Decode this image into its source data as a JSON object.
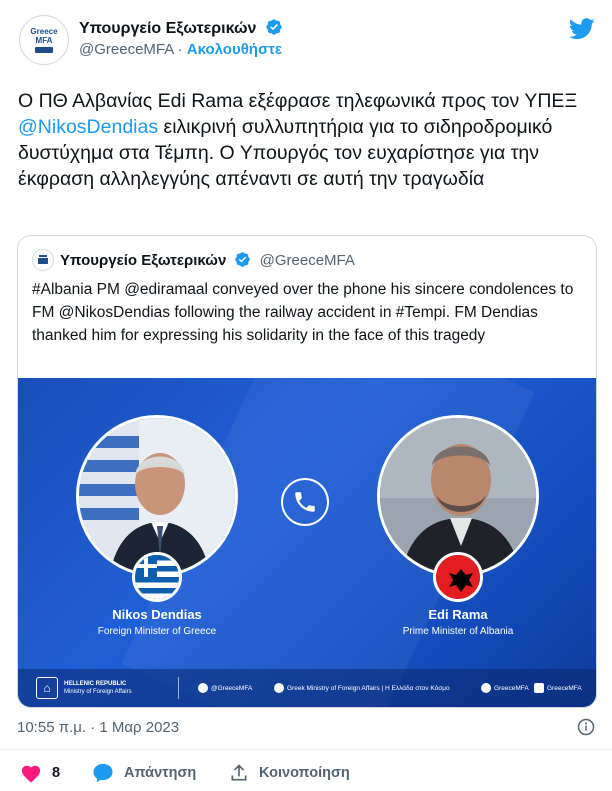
{
  "header": {
    "avatar_line1": "Greece",
    "avatar_line2": "MFA",
    "name": "Υπουργείο Εξωτερικών",
    "handle": "@GreeceMFA",
    "separator": "·",
    "follow": "Ακολουθήστε"
  },
  "tweet": {
    "text_before": "Ο ΠΘ Αλβανίας Edi Rama εξέφρασε τηλεφωνικά προς τον ΥΠΕΞ ",
    "mention": "@NikosDendias",
    "text_after": " ειλικρινή συλλυπητήρια για το σιδηροδρομικό δυστύχημα στα Τέμπη. Ο Υπουργός τον ευχαρίστησε για την έκφραση αλληλεγγύης απέναντι σε αυτή την τραγωδία"
  },
  "quote": {
    "name": "Υπουργείο Εξωτερικών",
    "handle": "@GreeceMFA",
    "text": "#Albania PM @ediramaal conveyed over the phone his sincere condolences to FM @NikosDendias following the railway accident in #Tempi. FM Dendias thanked him for expressing his solidarity in the face of this tragedy",
    "image": {
      "left_name": "Nikos Dendias",
      "left_title": "Foreign Minister of Greece",
      "right_name": "Edi Rama",
      "right_title": "Prime Minister of Albania",
      "org_line1": "HELLENIC REPUBLIC",
      "org_line2": "Ministry of Foreign Affairs",
      "social": [
        "@GreeceMFA",
        "Greek Ministry of Foreign Affairs | Η Ελλάδα στον Κόσμο",
        "GreeceMFA",
        "GreeceMFA"
      ]
    }
  },
  "meta": {
    "timestamp": "10:55 π.μ. · 1 Μαρ 2023"
  },
  "actions": {
    "likes": "8",
    "reply": "Απάντηση",
    "share": "Κοινοποίηση"
  },
  "colors": {
    "accent": "#1d9bf0",
    "like": "#f91880",
    "image_bg": "#1f5fd6"
  }
}
